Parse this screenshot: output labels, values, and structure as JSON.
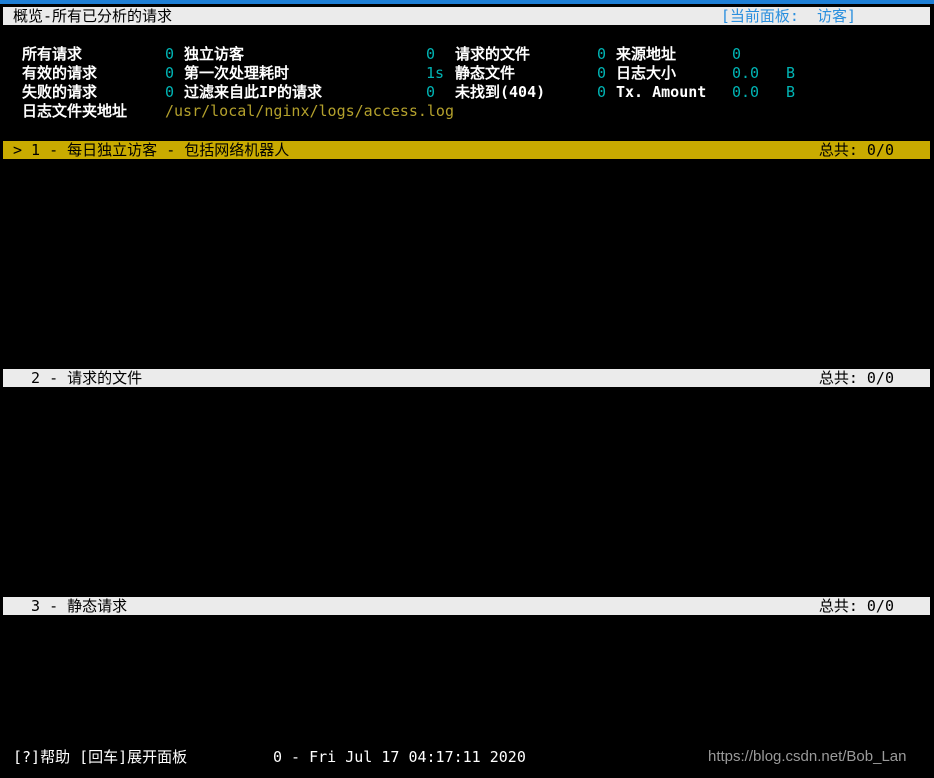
{
  "header": {
    "title": "概览-所有已分析的请求",
    "current_panel": "[当前面板:  访客]"
  },
  "stats": [
    {
      "label": "所有请求",
      "value": "0"
    },
    {
      "label": "有效的请求",
      "value": "0"
    },
    {
      "label": "失败的请求",
      "value": "0"
    },
    {
      "label": "日志文件夹地址",
      "value": "/usr/local/nginx/logs/access.log"
    },
    {
      "label": "独立访客",
      "value": "0"
    },
    {
      "label": "第一次处理耗时",
      "value": "1s"
    },
    {
      "label": "过滤来自此IP的请求",
      "value": "0"
    },
    {
      "label": "请求的文件",
      "value": "0"
    },
    {
      "label": "静态文件",
      "value": "0"
    },
    {
      "label": "未找到(404)",
      "value": "0"
    },
    {
      "label": "来源地址",
      "value": "0"
    },
    {
      "label": "日志大小",
      "value": "0.0",
      "unit": "B"
    },
    {
      "label": "Tx. Amount",
      "value": "0.0",
      "unit": "B"
    }
  ],
  "panels": [
    {
      "title": "> 1 - 每日独立访客 - 包括网络机器人",
      "total": "总共: 0/0"
    },
    {
      "title": "  2 - 请求的文件",
      "total": "总共: 0/0"
    },
    {
      "title": "  3 - 静态请求",
      "total": "总共: 0/0"
    }
  ],
  "footer": {
    "help": "[?]帮助 [回车]展开面板",
    "status": "0 - Fri Jul 17 04:17:11 2020"
  },
  "watermark": "https://blog.csdn.net/Bob_Lan",
  "colors": {
    "accent_blue": "#2a8fde",
    "active_panel": "#c9ab00",
    "value_cyan": "#00b4b4",
    "path_gold": "#b3a02c"
  }
}
